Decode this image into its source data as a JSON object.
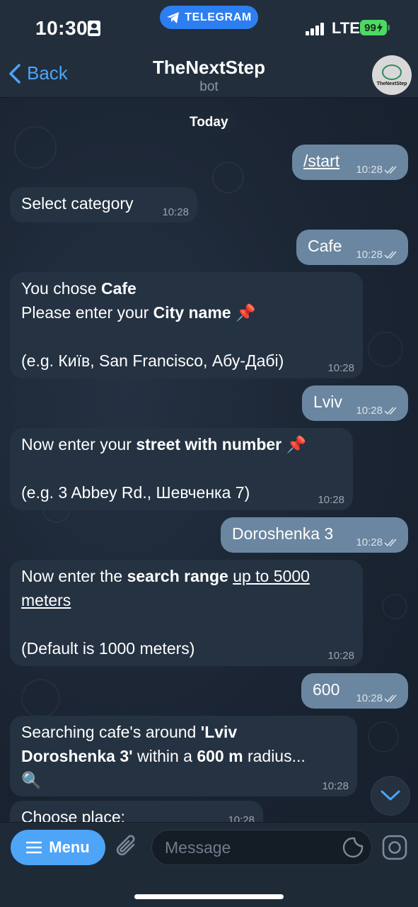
{
  "status_bar": {
    "time": "10:30",
    "carrier": "TELEGRAM",
    "network": "LTE",
    "battery": "99"
  },
  "header": {
    "back_label": "Back",
    "title": "TheNextStep",
    "subtitle": "bot",
    "avatar_text": "TheNextStep"
  },
  "date_chip": "Today",
  "messages": {
    "m1": {
      "text": "/start",
      "time": "10:28"
    },
    "m2": {
      "text": "Select category",
      "time": "10:28"
    },
    "m3": {
      "text": "Cafe",
      "time": "10:28"
    },
    "m4": {
      "l1_pre": "You chose ",
      "l1_bold": "Cafe",
      "l2_pre": "Please enter your ",
      "l2_bold": "City name",
      "l2_emoji": "📌",
      "l3": "(e.g. Київ, San Francisco, Абу-Дабі)",
      "time": "10:28"
    },
    "m5": {
      "text": "Lviv",
      "time": "10:28"
    },
    "m6": {
      "l1_pre": "Now enter your ",
      "l1_bold": "street with number",
      "l1_emoji": "📌",
      "l2": "(e.g. 3 Abbey Rd., Шевченка 7)",
      "time": "10:28"
    },
    "m7": {
      "text": "Doroshenka 3",
      "time": "10:28"
    },
    "m8": {
      "l1_pre": "Now enter the ",
      "l1_bold": "search range",
      "l1_space": " ",
      "l1_u": "up to 5000 ",
      "l2_u": "meters",
      "l3": "(Default is 1000 meters)",
      "time": "10:28"
    },
    "m9": {
      "text": "600",
      "time": "10:28"
    },
    "m10": {
      "l1_pre": "Searching cafe's around ",
      "l1_bold": "'Lviv",
      "l2_bold": "Doroshenka 3'",
      "l2_mid": " within a ",
      "l2_bold2": "600 m",
      "l2_post": " radius...",
      "l3_emoji": "🔍",
      "time": "10:28"
    },
    "m11": {
      "text": "Choose place:",
      "time": "10:28"
    }
  },
  "bottom_bar": {
    "menu_label": "Menu",
    "input_placeholder": "Message"
  },
  "colors": {
    "accent": "#4ea4f6",
    "outgoing_bubble": "#6b86a0",
    "incoming_bubble": "#243242",
    "battery": "#4cd964"
  }
}
